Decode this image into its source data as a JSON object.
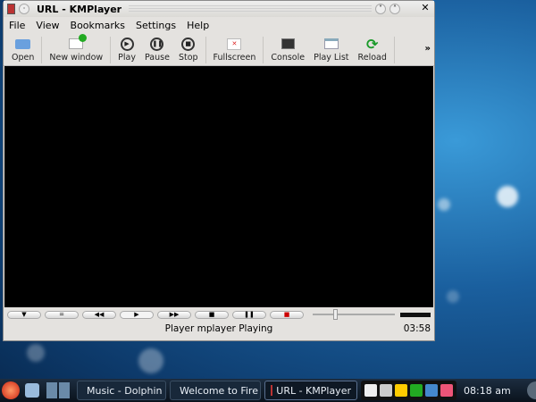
{
  "window": {
    "title": "URL - KMPlayer"
  },
  "menu": [
    "File",
    "View",
    "Bookmarks",
    "Settings",
    "Help"
  ],
  "toolbar": [
    {
      "label": "Open",
      "icon": "printer-open-icon"
    },
    {
      "label": "New window",
      "icon": "new-window-icon"
    },
    {
      "label": "Play",
      "icon": "play-icon"
    },
    {
      "label": "Pause",
      "icon": "pause-icon"
    },
    {
      "label": "Stop",
      "icon": "stop-icon"
    },
    {
      "label": "Fullscreen",
      "icon": "fullscreen-icon"
    },
    {
      "label": "Console",
      "icon": "console-icon"
    },
    {
      "label": "Play List",
      "icon": "playlist-icon"
    },
    {
      "label": "Reload",
      "icon": "reload-icon"
    }
  ],
  "toolbar_more": "»",
  "controls": [
    "▼",
    "=",
    "◀◀",
    "▶",
    "▶▶",
    "■",
    "❚❚",
    "■"
  ],
  "seek_position": 0.25,
  "status": {
    "message": "Player mplayer Playing",
    "time": "03:58"
  },
  "taskbar": {
    "tasks": [
      "Music - Dolphin",
      "Welcome to Fire",
      "URL - KMPlayer"
    ],
    "clock": "08:18 am"
  }
}
